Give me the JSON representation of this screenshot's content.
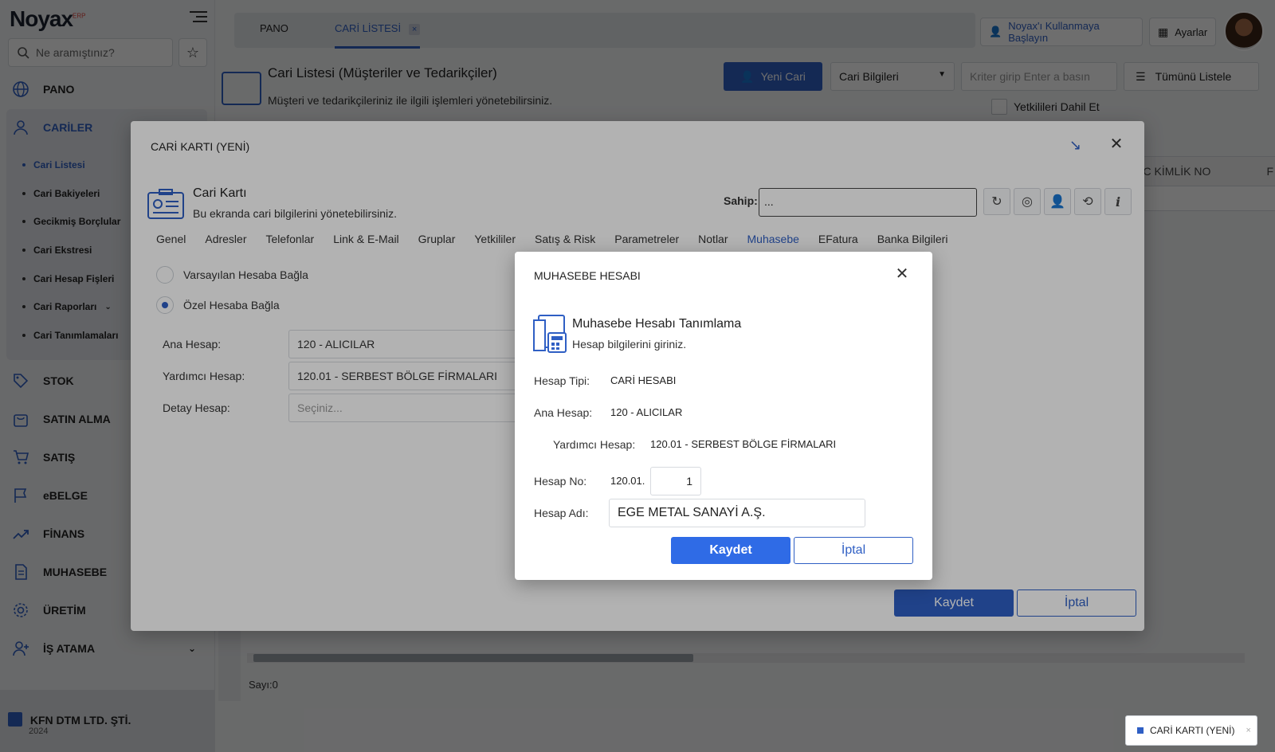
{
  "app": {
    "logo": "Noyax",
    "logo_sup": "ERP"
  },
  "search": {
    "placeholder": "Ne aramıştınız?"
  },
  "sidebar": {
    "items": [
      {
        "label": "PANO",
        "icon": "globe-icon"
      },
      {
        "label": "CARİLER",
        "icon": "user-icon"
      },
      {
        "label": "STOK",
        "icon": "tag-icon"
      },
      {
        "label": "SATIN ALMA",
        "icon": "bag-icon"
      },
      {
        "label": "SATIŞ",
        "icon": "cart-icon"
      },
      {
        "label": "eBELGE",
        "icon": "flag-icon"
      },
      {
        "label": "FİNANS",
        "icon": "trend-icon"
      },
      {
        "label": "MUHASEBE",
        "icon": "document-icon"
      },
      {
        "label": "ÜRETİM",
        "icon": "gear-icon"
      },
      {
        "label": "İŞ ATAMA",
        "icon": "user-plus-icon"
      }
    ],
    "sub_items": [
      "Cari Listesi",
      "Cari Bakiyeleri",
      "Gecikmiş Borçlular",
      "Cari Ekstresi",
      "Cari Hesap Fişleri",
      "Cari Raporları",
      "Cari Tanımlamaları"
    ],
    "company": "KFN DTM LTD. ŞTİ.",
    "year": "2024"
  },
  "header": {
    "tabs": [
      "PANO",
      "CARİ LİSTESİ"
    ],
    "tab_close": "×",
    "help_button": "Noyax'ı Kullanmaya Başlayın",
    "settings_button": "Ayarlar"
  },
  "page": {
    "title": "Cari Listesi (Müşteriler ve Tedarikçiler)",
    "subtitle": "Müşteri ve tedarikçileriniz ile ilgili işlemleri yönetebilirsiniz.",
    "new_button": "Yeni Cari",
    "select_value": "Cari Bilgileri",
    "criteria_placeholder": "Kriter girip Enter a basın",
    "list_all": "Tümünü Listele",
    "include_authorized": "Yetkilileri Dahil Et",
    "grid_col": "TC KİMLİK NO",
    "grid_col_next": "F",
    "count": "Sayı:0"
  },
  "cari_modal": {
    "title": "CARİ KARTI (YENİ)",
    "heading": "Cari Kartı",
    "subheading": "Bu ekranda cari bilgilerini yönetebilirsiniz.",
    "owner_label": "Sahip:",
    "owner_value": "...",
    "tabs": [
      "Genel",
      "Adresler",
      "Telefonlar",
      "Link & E-Mail",
      "Gruplar",
      "Yetkililer",
      "Satış & Risk",
      "Parametreler",
      "Notlar",
      "Muhasebe",
      "EFatura",
      "Banka Bilgileri"
    ],
    "active_tab": "Muhasebe",
    "radio_default": "Varsayılan Hesaba Bağla",
    "radio_custom": "Özel Hesaba Bağla",
    "selected_radio": "Özel Hesaba Bağla",
    "ana_label": "Ana Hesap:",
    "ana_value": "120 -  ALICILAR",
    "yardimci_label": "Yardımcı Hesap:",
    "yardimci_value": "120.01 - SERBEST BÖLGE FİRMALARI",
    "detay_label": "Detay Hesap:",
    "detay_placeholder": "Seçiniz...",
    "save": "Kaydet",
    "cancel": "İptal"
  },
  "muhasebe_modal": {
    "title": "MUHASEBE HESABI",
    "heading": "Muhasebe Hesabı Tanımlama",
    "subheading": "Hesap bilgilerini giriniz.",
    "tip_label": "Hesap Tipi:",
    "tip_value": "CARİ HESABI",
    "ana_label": "Ana Hesap:",
    "ana_value": "120 - ALICILAR",
    "yardimci_label": "Yardımcı Hesap:",
    "yardimci_value": "120.01 - SERBEST BÖLGE FİRMALARI",
    "no_label": "Hesap No:",
    "no_prefix": "120.01.",
    "no_value": "1",
    "ad_label": "Hesap Adı:",
    "ad_value": "EGE METAL SANAYİ A.Ş.",
    "save": "Kaydet",
    "cancel": "İptal"
  },
  "taskbar": {
    "chip": "CARİ KARTI (YENİ)",
    "chip_close": "×"
  },
  "colors": {
    "accent": "#2f5fc4",
    "primary_button": "#2f6be6"
  }
}
